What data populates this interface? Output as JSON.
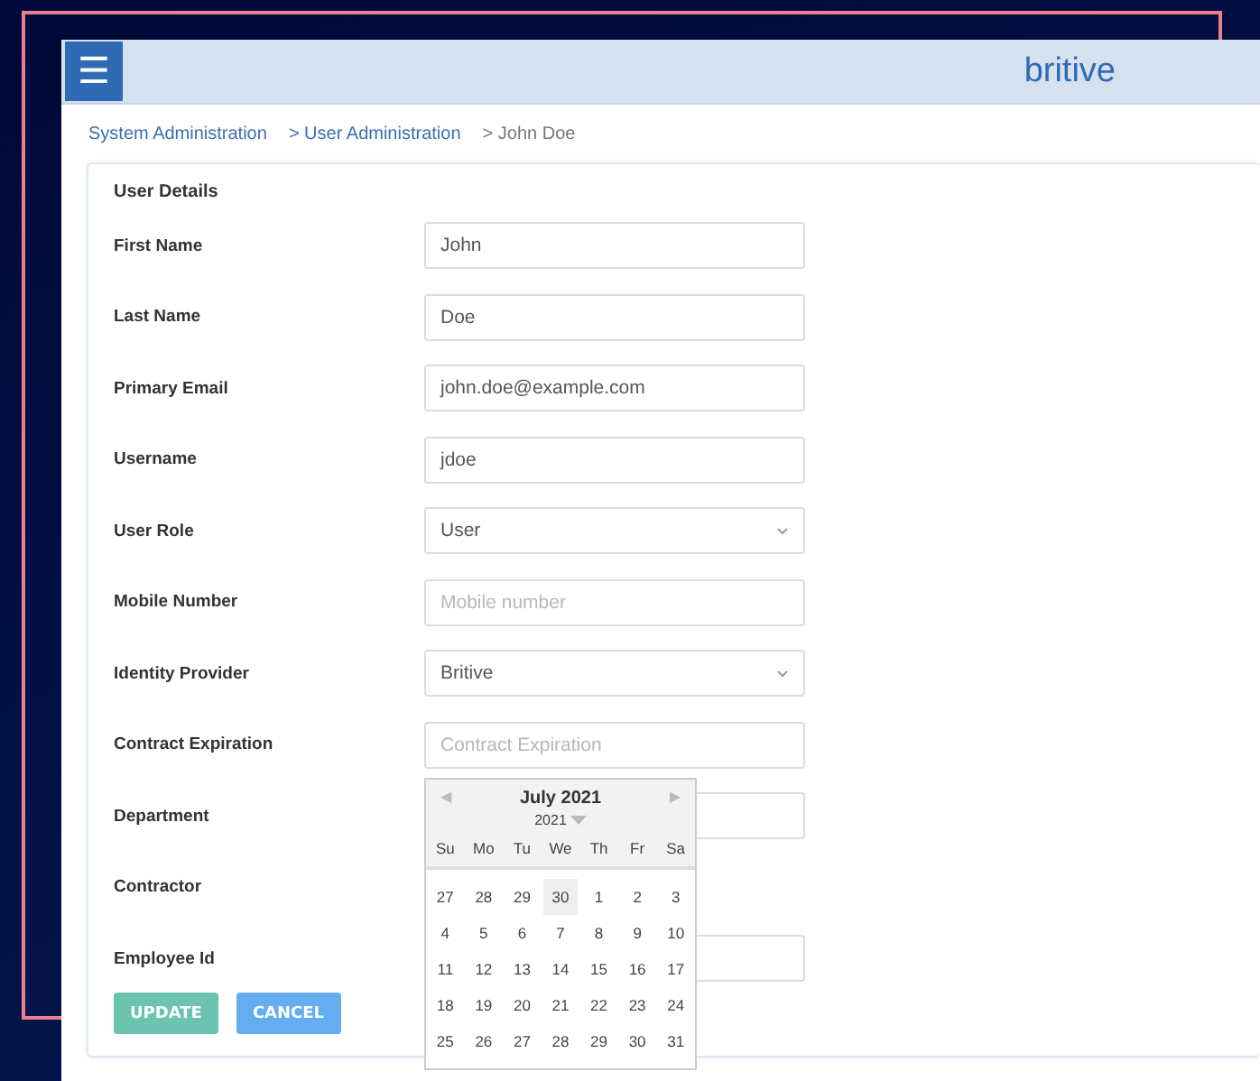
{
  "header": {
    "menu_icon": "☰",
    "logo": "britive"
  },
  "breadcrumb": [
    {
      "label": "System Administration",
      "link": true
    },
    {
      "label": "> User Administration",
      "link": true
    },
    {
      "label": "> John Doe",
      "link": false
    }
  ],
  "card": {
    "title": "User Details",
    "fields": [
      {
        "label": "First Name",
        "kind": "text",
        "value": "John"
      },
      {
        "label": "Last Name",
        "kind": "text",
        "value": "Doe"
      },
      {
        "label": "Primary Email",
        "kind": "text",
        "value": "john.doe@example.com"
      },
      {
        "label": "Username",
        "kind": "text",
        "value": "jdoe"
      },
      {
        "label": "User Role",
        "kind": "select",
        "value": "User"
      },
      {
        "label": "Mobile Number",
        "kind": "text",
        "placeholder": "Mobile number"
      },
      {
        "label": "Identity Provider",
        "kind": "select",
        "value": "Britive"
      },
      {
        "label": "Contract Expiration",
        "kind": "date",
        "placeholder": "Contract Expiration"
      },
      {
        "label": "Department",
        "kind": "text"
      },
      {
        "label": "Contractor",
        "kind": "none"
      },
      {
        "label": "Employee Id",
        "kind": "text"
      }
    ],
    "buttons": [
      {
        "label": "UPDATE",
        "kind": "primary"
      },
      {
        "label": "CANCEL",
        "kind": "secondary"
      }
    ]
  },
  "datepicker": {
    "prev": "◀",
    "next": "▶",
    "month_title": "July 2021",
    "year": "2021",
    "weekdays": [
      "Su",
      "Mo",
      "Tu",
      "We",
      "Th",
      "Fr",
      "Sa"
    ],
    "weeks": [
      [
        {
          "label": "27",
          "highlighted": false
        },
        {
          "label": "28",
          "highlighted": false
        },
        {
          "label": "29",
          "highlighted": false
        },
        {
          "label": "30",
          "highlighted": true
        },
        {
          "label": "1",
          "highlighted": false
        },
        {
          "label": "2",
          "highlighted": false
        },
        {
          "label": "3",
          "highlighted": false
        }
      ],
      [
        {
          "label": "4",
          "highlighted": false
        },
        {
          "label": "5",
          "highlighted": false
        },
        {
          "label": "6",
          "highlighted": false
        },
        {
          "label": "7",
          "highlighted": false
        },
        {
          "label": "8",
          "highlighted": false
        },
        {
          "label": "9",
          "highlighted": false
        },
        {
          "label": "10",
          "highlighted": false
        }
      ],
      [
        {
          "label": "11",
          "highlighted": false
        },
        {
          "label": "12",
          "highlighted": false
        },
        {
          "label": "13",
          "highlighted": false
        },
        {
          "label": "14",
          "highlighted": false
        },
        {
          "label": "15",
          "highlighted": false
        },
        {
          "label": "16",
          "highlighted": false
        },
        {
          "label": "17",
          "highlighted": false
        }
      ],
      [
        {
          "label": "18",
          "highlighted": false
        },
        {
          "label": "19",
          "highlighted": false
        },
        {
          "label": "20",
          "highlighted": false
        },
        {
          "label": "21",
          "highlighted": false
        },
        {
          "label": "22",
          "highlighted": false
        },
        {
          "label": "23",
          "highlighted": false
        },
        {
          "label": "24",
          "highlighted": false
        }
      ],
      [
        {
          "label": "25",
          "highlighted": false
        },
        {
          "label": "26",
          "highlighted": false
        },
        {
          "label": "27",
          "highlighted": false
        },
        {
          "label": "28",
          "highlighted": false
        },
        {
          "label": "29",
          "highlighted": false
        },
        {
          "label": "30",
          "highlighted": false
        },
        {
          "label": "31",
          "highlighted": false
        }
      ]
    ]
  }
}
